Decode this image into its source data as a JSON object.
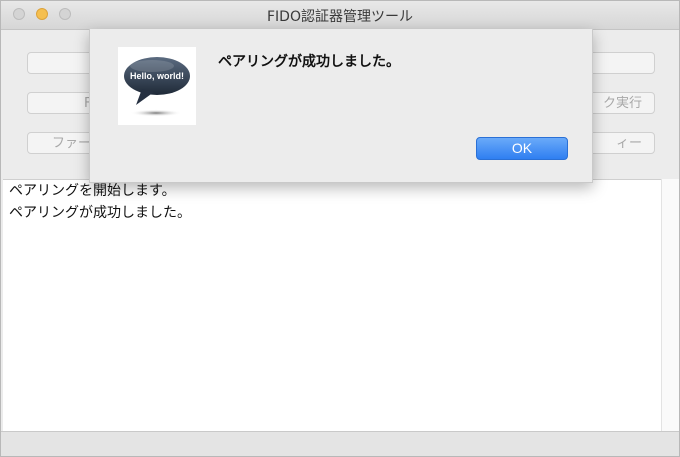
{
  "window": {
    "title": "FIDO認証器管理ツール"
  },
  "background_buttons": {
    "row1_left": "",
    "row1_right": "",
    "row2_left": "F",
    "row2_right": "ク実行",
    "row3_left": "ファー",
    "row3_right": "ィー"
  },
  "log": {
    "lines": [
      "ペアリングを開始します。",
      "ペアリングが成功しました。"
    ]
  },
  "alert": {
    "icon_text": "Hello, world!",
    "message": "ペアリングが成功しました。",
    "ok_label": "OK"
  },
  "colors": {
    "accent": "#2f7ff1",
    "minimize": "#f5bf4f"
  },
  "icons": {
    "app": "speech-bubble-icon"
  }
}
